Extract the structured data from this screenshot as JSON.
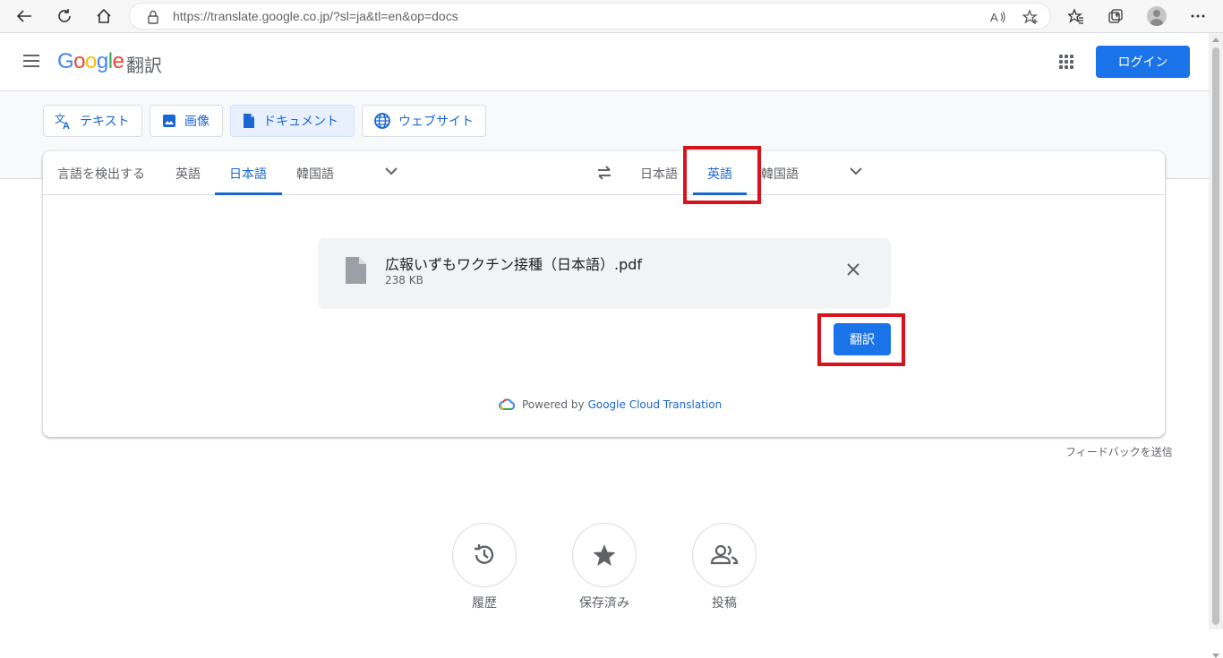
{
  "browser": {
    "url": "https://translate.google.co.jp/?sl=ja&tl=en&op=docs"
  },
  "header": {
    "logo_letters": [
      "G",
      "o",
      "o",
      "g",
      "l",
      "e"
    ],
    "logo_colors": [
      "#4285f4",
      "#ea4335",
      "#fbbc05",
      "#4285f4",
      "#34a853",
      "#ea4335"
    ],
    "product": "翻訳",
    "login_label": "ログイン"
  },
  "modes": [
    {
      "label": "テキスト",
      "icon": "translate-icon"
    },
    {
      "label": "画像",
      "icon": "image-icon"
    },
    {
      "label": "ドキュメント",
      "icon": "document-icon",
      "active": true
    },
    {
      "label": "ウェブサイト",
      "icon": "globe-icon"
    }
  ],
  "source_langs": {
    "detect": "言語を検出する",
    "items": [
      "英語",
      "日本語",
      "韓国語"
    ],
    "selected": "日本語"
  },
  "target_langs": {
    "items": [
      "日本語",
      "英語",
      "韓国語"
    ],
    "selected": "英語"
  },
  "file": {
    "name": "広報いずもワクチン接種（日本語）.pdf",
    "size": "238 KB"
  },
  "translate_label": "翻訳",
  "powered": {
    "prefix": "Powered by",
    "link": "Google Cloud Translation"
  },
  "feedback": "フィードバックを送信",
  "bottom_actions": [
    {
      "label": "履歴",
      "icon": "history-icon"
    },
    {
      "label": "保存済み",
      "icon": "star-icon"
    },
    {
      "label": "投稿",
      "icon": "people-icon"
    }
  ],
  "colors": {
    "accent": "#1a73e8",
    "link": "#1967d2",
    "highlight": "#d9121c"
  }
}
